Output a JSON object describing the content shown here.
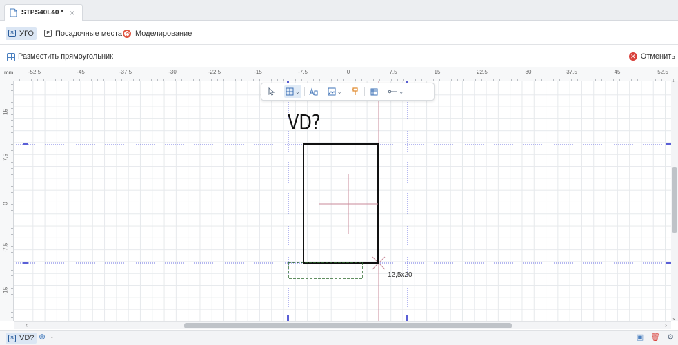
{
  "doc_tab": {
    "title": "STPS40L40 *",
    "close_glyph": "×"
  },
  "mode_tabs": [
    {
      "key": "S",
      "label": "УГО",
      "active": true
    },
    {
      "key": "F",
      "label": "Посадочные места",
      "active": false
    },
    {
      "label": "Моделирование",
      "active": false
    }
  ],
  "action_bar": {
    "label": "Разместить прямоугольник",
    "cancel_label": "Отменить"
  },
  "ruler": {
    "unit": "mm",
    "x_ticks": [
      "-52,5",
      "-45",
      "-37,5",
      "-30",
      "-22,5",
      "-15",
      "-7,5",
      "0",
      "7,5",
      "15",
      "22,5",
      "30",
      "37,5",
      "45",
      "52,5"
    ],
    "y_ticks": [
      "15",
      "7,5",
      "0",
      "-7,5",
      "-15"
    ]
  },
  "canvas": {
    "designator": "VD?",
    "size_readout": "12,5x20"
  },
  "bottom_bar": {
    "tab_key": "S",
    "tab_label": "VD?"
  },
  "colors": {
    "accent": "#4a7fbf",
    "guide": "#6a6fe0",
    "selection_dashed": "#2e6b2e",
    "cursor_line": "#c98a9a",
    "cancel": "#d9413b"
  }
}
